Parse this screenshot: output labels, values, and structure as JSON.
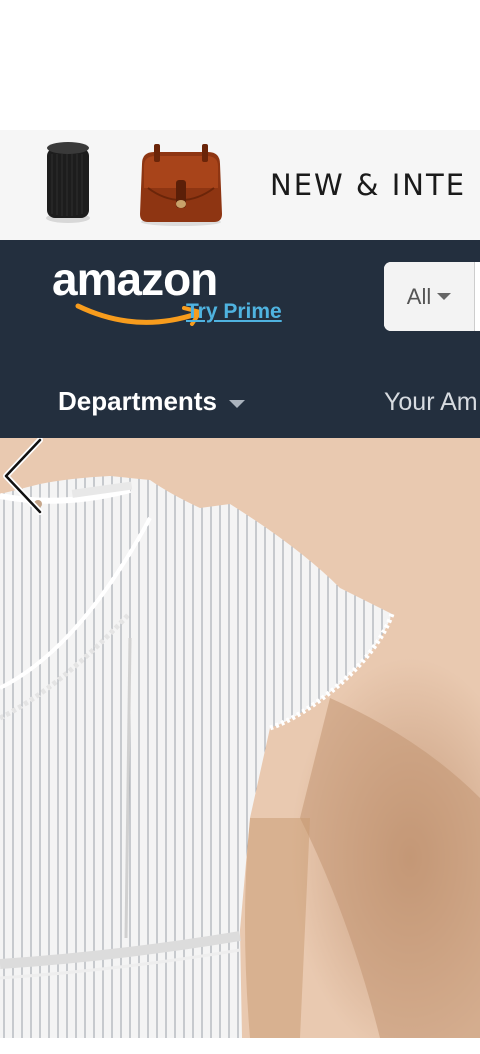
{
  "promo": {
    "text": "NEW & INTE"
  },
  "header": {
    "logo_text": "amazon",
    "try_prime_link": "Try Prime",
    "search_category": "All",
    "nav": {
      "departments_label": "Departments",
      "your_amazon_label": "Your Am"
    }
  },
  "icons": {
    "speaker": "speaker-product-icon",
    "satchel": "leather-bag-product-icon",
    "caret": "caret-down-icon",
    "prev": "chevron-left-icon"
  },
  "colors": {
    "header_bg": "#232f3e",
    "prime_link": "#4fb3e0",
    "smile": "#f79c1d",
    "hero_bg": "#e9c9b0"
  }
}
